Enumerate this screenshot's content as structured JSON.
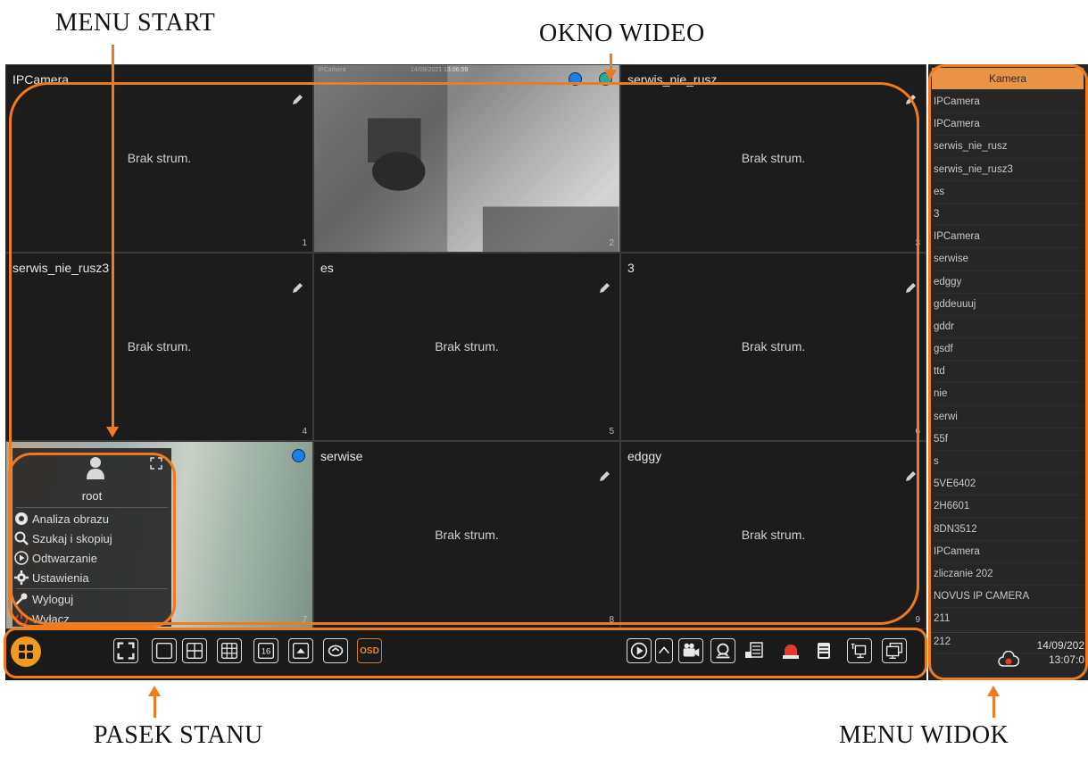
{
  "callouts": {
    "menu_start": "MENU START",
    "okno_wideo": "OKNO WIDEO",
    "pasek_stanu": "PASEK STANU",
    "menu_widok": "MENU WIDOK"
  },
  "tiles": [
    {
      "name": "IPCamera",
      "message": "Brak strum.",
      "number": "1"
    },
    {
      "name": "",
      "message": "",
      "number": "2",
      "osd_name": "IPCamera",
      "osd_time": "14/09/2021 13:06:59"
    },
    {
      "name": "serwis_nie_rusz",
      "message": "Brak strum.",
      "number": "3"
    },
    {
      "name": "serwis_nie_rusz3",
      "message": "Brak strum.",
      "number": "4"
    },
    {
      "name": "es",
      "message": "Brak strum.",
      "number": "5"
    },
    {
      "name": "3",
      "message": "Brak strum.",
      "number": "6"
    },
    {
      "name": "",
      "message": "",
      "number": "7"
    },
    {
      "name": "serwise",
      "message": "Brak strum.",
      "number": "8"
    },
    {
      "name": "edggy",
      "message": "Brak strum.",
      "number": "9"
    }
  ],
  "start_menu": {
    "user": "root",
    "items": [
      "Analiza obrazu",
      "Szukaj i skopiuj",
      "Odtwarzanie",
      "Ustawienia",
      "Wyloguj",
      "Wyłącz"
    ]
  },
  "toolbar": {
    "osd_label": "OSD",
    "grid16_label": "16"
  },
  "right_panel": {
    "header": "Kamera",
    "cameras": [
      "IPCamera",
      "IPCamera",
      "serwis_nie_rusz",
      "serwis_nie_rusz3",
      "es",
      "3",
      "IPCamera",
      "serwise",
      "edggy",
      "gddeuuuj",
      "gddr",
      "gsdf",
      "ttd",
      "nie",
      "serwi",
      "55f",
      "s",
      "5VE6402",
      "2H6601",
      "8DN3512",
      "IPCamera",
      "zliczanie 202",
      "NOVUS IP CAMERA",
      "211",
      "212"
    ],
    "date": "14/09/202",
    "time": "13:07:0"
  },
  "colors": {
    "accent_orange": "#f07a1e",
    "panel_header": "#e99347",
    "status_blue": "#1e7fe0",
    "status_teal": "#2aa8a0"
  }
}
